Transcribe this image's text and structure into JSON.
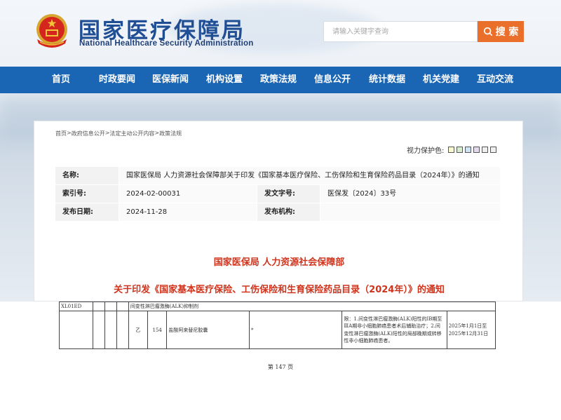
{
  "header": {
    "title_cn": "国家医疗保障局",
    "title_en": "National Healthcare Security Administration"
  },
  "search": {
    "placeholder": "请输入关键字查询",
    "button_label": "搜 索"
  },
  "nav": {
    "items": [
      "首页",
      "时政要闻",
      "医保新闻",
      "机构设置",
      "政策法规",
      "信息公开",
      "统计数据",
      "机关党建",
      "互动交流"
    ]
  },
  "breadcrumb": [
    "首页",
    "政府信息公开",
    "法定主动公开内容",
    "政策法规"
  ],
  "breadcrumb_sep": " > ",
  "vision": {
    "label": "视力保护色:",
    "colors": [
      "#fafad2",
      "#d8ecd1",
      "#cfe3f2",
      "#e3d9ec",
      "#eeeeee",
      "#f0f0f0"
    ]
  },
  "meta": {
    "name_label": "名称:",
    "name_value": "国家医保局 人力资源社会保障部关于印发《国家基本医疗保险、工伤保险和生育保险药品目录（2024年）》的通知",
    "index_label": "索引号:",
    "index_value": "2024-02-00031",
    "doc_no_label": "发文字号:",
    "doc_no_value": "医保发〔2024〕33号",
    "date_label": "发布日期:",
    "date_value": "2024-11-28",
    "agency_label": "发布机构:",
    "agency_value": ""
  },
  "article": {
    "org": "国家医保局 人力资源社会保障部",
    "title": "关于印发《国家基本医疗保险、工伤保险和生育保险药品目录（2024年）》的通知"
  },
  "doc_table": {
    "code": "XL01ED",
    "category": "间变性淋巴瘤激酶(ALK)抑制剂",
    "class": "乙",
    "number": "154",
    "drug": "盐酸阿来替尼胶囊",
    "mark": "*",
    "restriction": "限：1.间变性淋巴瘤激酶(ALK)阳性的ⅠB期至ⅢA期非小细胞肺癌患者术后辅助治疗；2.间变性淋巴瘤激酶(ALK)阳性的局部晚期或转移性非小细胞肺癌患者。",
    "validity": "2025年1月1日至2025年12月31日"
  },
  "page_number": "第 147 页"
}
